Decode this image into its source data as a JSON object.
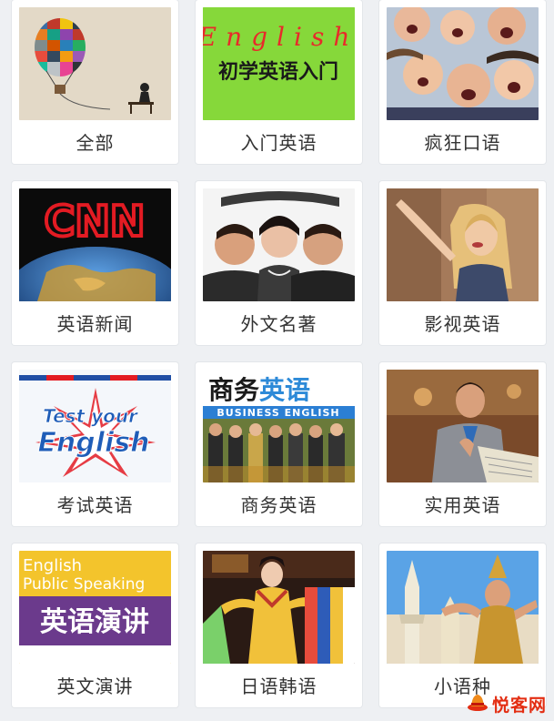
{
  "categories": [
    {
      "id": "all",
      "label": "全部",
      "icon": "hot-air-balloon-image"
    },
    {
      "id": "beginner",
      "label": "入门英语",
      "icon": "beginner-english-cover-image",
      "cover_top": "English",
      "cover_bottom": "初学英语入门"
    },
    {
      "id": "crazy",
      "label": "疯狂口语",
      "icon": "shouting-people-image"
    },
    {
      "id": "news",
      "label": "英语新闻",
      "icon": "cnn-globe-image",
      "cover_text": "CNN"
    },
    {
      "id": "classics",
      "label": "外文名著",
      "icon": "classic-film-stars-image"
    },
    {
      "id": "film",
      "label": "影视英语",
      "icon": "actress-image"
    },
    {
      "id": "exam",
      "label": "考试英语",
      "icon": "test-your-english-logo-image",
      "cover_top": "Test your",
      "cover_bottom": "English"
    },
    {
      "id": "business",
      "label": "商务英语",
      "icon": "business-english-image",
      "cover_top_a": "商务",
      "cover_top_b": "英语",
      "cover_bar": "BUSINESS ENGLISH"
    },
    {
      "id": "practical",
      "label": "实用英语",
      "icon": "businessman-newspaper-image"
    },
    {
      "id": "speech",
      "label": "英文演讲",
      "icon": "public-speaking-cover-image",
      "cover_top": "English",
      "cover_mid": "Public Speaking",
      "cover_bottom": "英语演讲"
    },
    {
      "id": "jpkr",
      "label": "日语韩语",
      "icon": "korean-dancer-image"
    },
    {
      "id": "minor",
      "label": "小语种",
      "icon": "thai-dancer-image"
    }
  ],
  "watermark": {
    "text": "悦客网",
    "icon": "hat-logo-icon"
  },
  "colors": {
    "page_bg": "#eef0f3",
    "card_bg": "#ffffff",
    "label": "#333333",
    "watermark": "#e32d12"
  }
}
